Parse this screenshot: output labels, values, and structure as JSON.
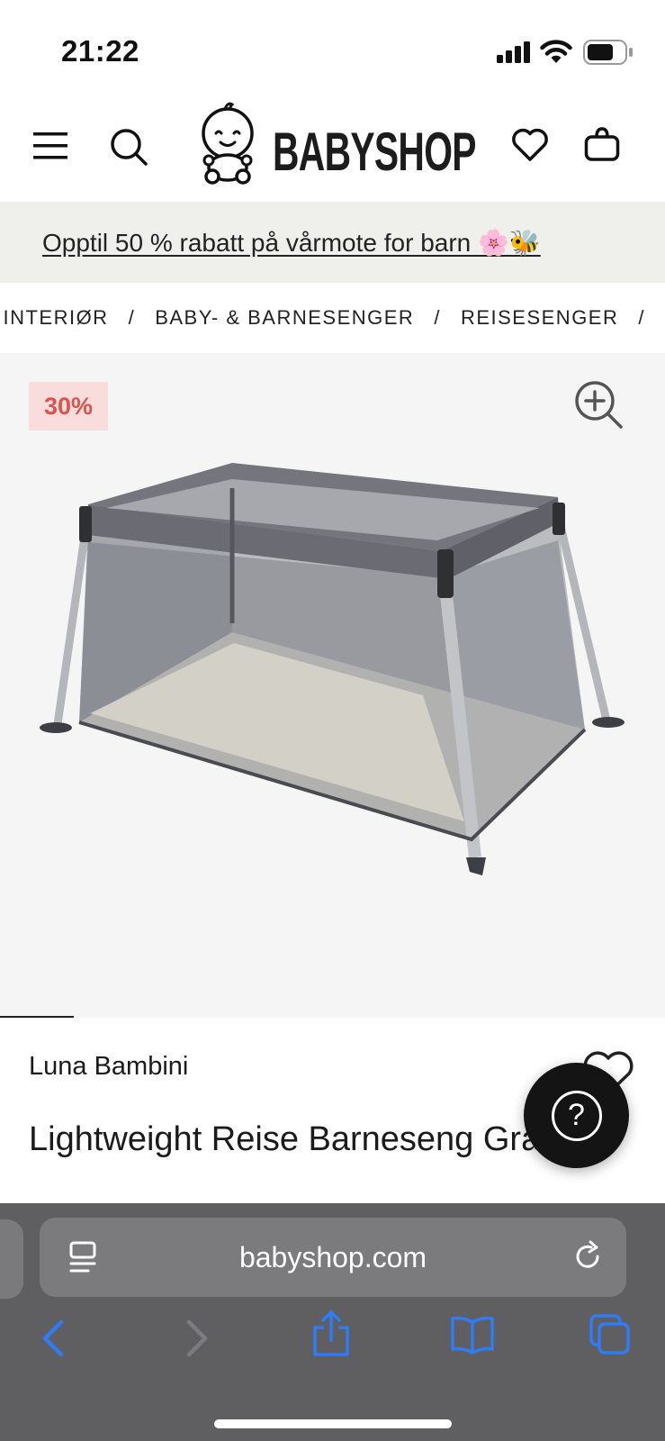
{
  "status_bar": {
    "time": "21:22"
  },
  "header": {
    "brand": "BABYSHOP",
    "icons": [
      "menu-icon",
      "search-icon",
      "logo-icon",
      "heart-icon",
      "bag-icon"
    ]
  },
  "promo": {
    "text": "Opptil 50 % rabatt på vårmote for barn 🌸🐝"
  },
  "breadcrumb": {
    "items": [
      "INTERIØR",
      "BABY- & BARNESENGER",
      "REISESENGER"
    ],
    "separator": "/"
  },
  "gallery": {
    "discount": "30%"
  },
  "product": {
    "brand": "Luna Bambini",
    "title": "Lightweight Reise Barneseng Grå"
  },
  "help": {
    "label": "?"
  },
  "browser": {
    "url": "babyshop.com"
  },
  "colors": {
    "badge_bg": "#f9dcdc",
    "badge_text": "#d7554e",
    "ios_blue": "#2f7cf6",
    "toolbar_bg": "#5f5f61"
  }
}
